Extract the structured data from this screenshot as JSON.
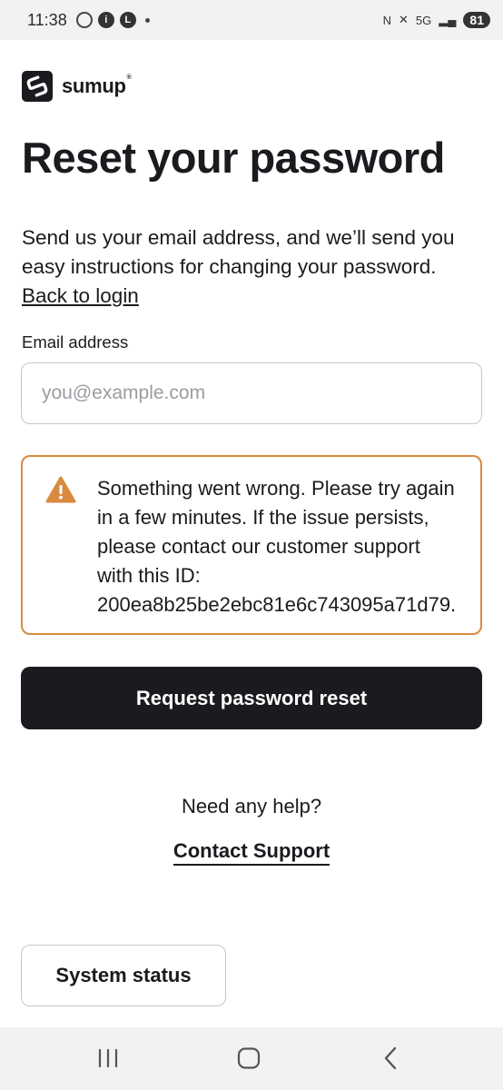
{
  "status_bar": {
    "time": "11:38",
    "battery": "81",
    "network": "5G"
  },
  "brand": {
    "name": "sumup",
    "registered": "®"
  },
  "page": {
    "title": "Reset your password",
    "intro": "Send us your email address, and we’ll send you easy instructions for changing your password.",
    "back_link": "Back to login"
  },
  "form": {
    "email_label": "Email address",
    "email_placeholder": "you@example.com",
    "email_value": ""
  },
  "alert": {
    "lines": [
      "Something went wrong. Please try again",
      "in a few minutes. If the issue persists,",
      "please contact our customer support",
      "with this ID:",
      "200ea8b25be2ebc81e6c743095a71d79."
    ],
    "icon": "warning-icon",
    "color": "#d98a3f"
  },
  "actions": {
    "request_label": "Request password reset",
    "help_text": "Need any help?",
    "contact_label": "Contact Support",
    "system_status_label": "System status"
  },
  "nav": {
    "recents": "recents-icon",
    "home": "home-icon",
    "back": "back-icon"
  }
}
